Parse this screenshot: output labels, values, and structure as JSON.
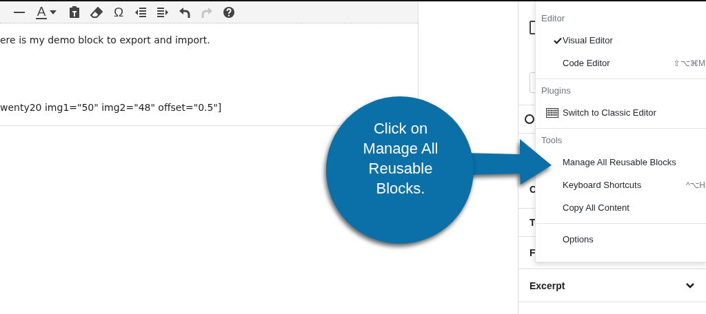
{
  "toolbar": [
    {
      "kind": "rule"
    },
    {
      "kind": "text-color",
      "glyph": "A"
    },
    {
      "kind": "caret"
    },
    {
      "kind": "paste"
    },
    {
      "kind": "eraser"
    },
    {
      "kind": "glyph",
      "glyph": "Ω"
    },
    {
      "kind": "outdent"
    },
    {
      "kind": "indent"
    },
    {
      "kind": "undo",
      "disabled": false
    },
    {
      "kind": "redo",
      "disabled": true
    },
    {
      "kind": "help"
    }
  ],
  "editor": {
    "lines": [
      "ere is my demo block to export and import.",
      "wenty20 img1=\"50\" img2=\"48\" offset=\"0.5\"]"
    ]
  },
  "sidebar": {
    "checkbox": {
      "checked": false
    },
    "rows": [
      {
        "label": "C"
      },
      {
        "label": "T"
      },
      {
        "label": "F"
      },
      {
        "label": "Excerpt",
        "expanded": false
      }
    ]
  },
  "menu": {
    "sections": [
      {
        "title": "Editor",
        "items": [
          {
            "label": "Visual Editor",
            "checked": true
          },
          {
            "label": "Code Editor",
            "checked": false,
            "shortcut": "⇧⌥⌘M"
          }
        ]
      },
      {
        "title": "Plugins",
        "items": [
          {
            "label": "Switch to Classic Editor",
            "kind": "keyboard"
          }
        ]
      },
      {
        "title": "Tools",
        "items": [
          {
            "label": "Manage All Reusable Blocks"
          },
          {
            "label": "Keyboard Shortcuts",
            "shortcut": "^⌥H"
          },
          {
            "label": "Copy All Content"
          }
        ]
      },
      {
        "items": [
          {
            "label": "Options"
          }
        ]
      }
    ]
  },
  "callout": {
    "text": "Click on Manage All Reusable Blocks."
  }
}
